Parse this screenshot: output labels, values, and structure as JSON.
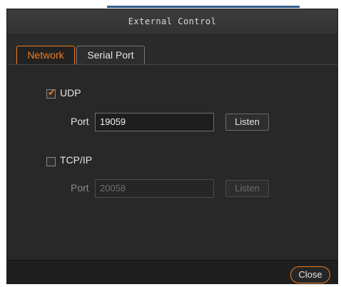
{
  "window": {
    "title": "External Control"
  },
  "tabs": [
    {
      "label": "Network",
      "active": true
    },
    {
      "label": "Serial Port",
      "active": false
    }
  ],
  "udp": {
    "label": "UDP",
    "checked": true,
    "port_label": "Port",
    "port_value": "19059",
    "listen_label": "Listen"
  },
  "tcp": {
    "label": "TCP/IP",
    "checked": false,
    "port_label": "Port",
    "port_value": "20058",
    "listen_label": "Listen"
  },
  "footer": {
    "close_label": "Close"
  },
  "colors": {
    "accent": "#f07c21",
    "background": "#2b2b2b"
  },
  "icons": {
    "check": "checkmark-icon"
  }
}
